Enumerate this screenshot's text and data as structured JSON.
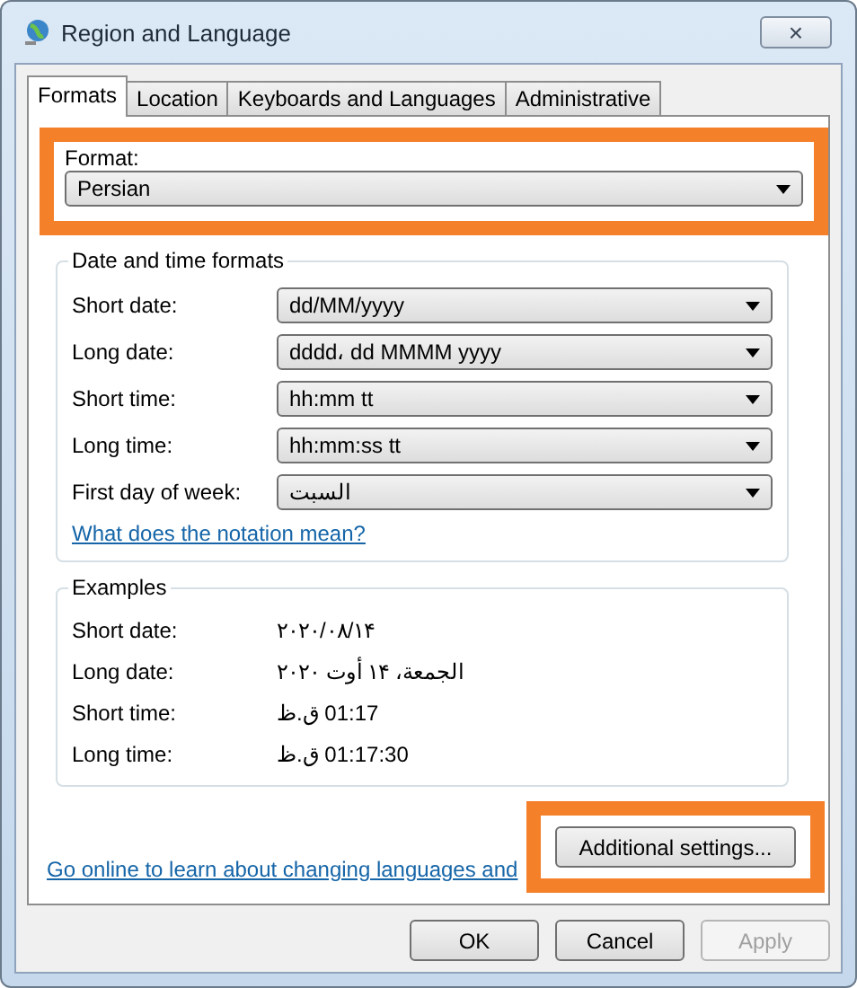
{
  "window": {
    "title": "Region and Language",
    "close": "×"
  },
  "tabs": [
    {
      "label": "Formats",
      "selected": true
    },
    {
      "label": "Location",
      "selected": false
    },
    {
      "label": "Keyboards and Languages",
      "selected": false
    },
    {
      "label": "Administrative",
      "selected": false
    }
  ],
  "format": {
    "label": "Format:",
    "value": "Persian",
    "highlighted": true
  },
  "date_time_formats": {
    "title": "Date and time formats",
    "rows": [
      {
        "label": "Short date:",
        "value": "dd/MM/yyyy"
      },
      {
        "label": "Long date:",
        "value": "dddd، dd MMMM yyyy"
      },
      {
        "label": "Short time:",
        "value": "hh:mm tt"
      },
      {
        "label": "Long time:",
        "value": "hh:mm:ss tt"
      },
      {
        "label": "First day of week:",
        "value": "السبت"
      }
    ],
    "link": "What does the notation mean?"
  },
  "examples": {
    "title": "Examples",
    "rows": [
      {
        "label": "Short date:",
        "value": "۲۰۲۰/۰۸/۱۴"
      },
      {
        "label": "Long date:",
        "value": "الجمعة، ۱۴ أوت ۲۰۲۰"
      },
      {
        "label": "Short time:",
        "value": "01:17 ق.ظ"
      },
      {
        "label": "Long time:",
        "value": "01:17:30 ق.ظ"
      }
    ]
  },
  "additional_settings": {
    "label": "Additional settings...",
    "highlighted": true
  },
  "online_link": "Go online to learn about changing languages and",
  "buttons": [
    {
      "label": "OK",
      "disabled": false
    },
    {
      "label": "Cancel",
      "disabled": false
    },
    {
      "label": "Apply",
      "disabled": true
    }
  ]
}
